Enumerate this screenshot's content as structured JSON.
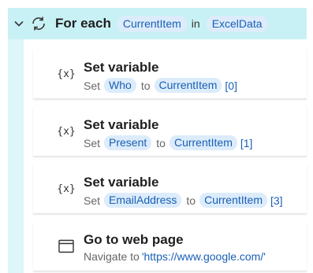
{
  "foreach": {
    "title": "For each",
    "item_var": "CurrentItem",
    "in_label": "in",
    "collection_var": "ExcelData"
  },
  "actions": [
    {
      "icon": "variable-icon",
      "glyph": "{x}",
      "title": "Set variable",
      "prefix": "Set",
      "var": "Who",
      "to_label": "to",
      "value_var": "CurrentItem",
      "index": "[0]"
    },
    {
      "icon": "variable-icon",
      "glyph": "{x}",
      "title": "Set variable",
      "prefix": "Set",
      "var": "Present",
      "to_label": "to",
      "value_var": "CurrentItem",
      "index": "[1]"
    },
    {
      "icon": "variable-icon",
      "glyph": "{x}",
      "title": "Set variable",
      "prefix": "Set",
      "var": "EmailAddress",
      "to_label": "to",
      "value_var": "CurrentItem",
      "index": "[3]"
    },
    {
      "icon": "browser-window-icon",
      "title": "Go to web page",
      "prefix": "Navigate to",
      "url": "'https://www.google.com/'"
    }
  ],
  "colors": {
    "header_bg": "#c8f1f5",
    "token_bg": "#dcecfb",
    "token_text": "#1a5fb4"
  }
}
